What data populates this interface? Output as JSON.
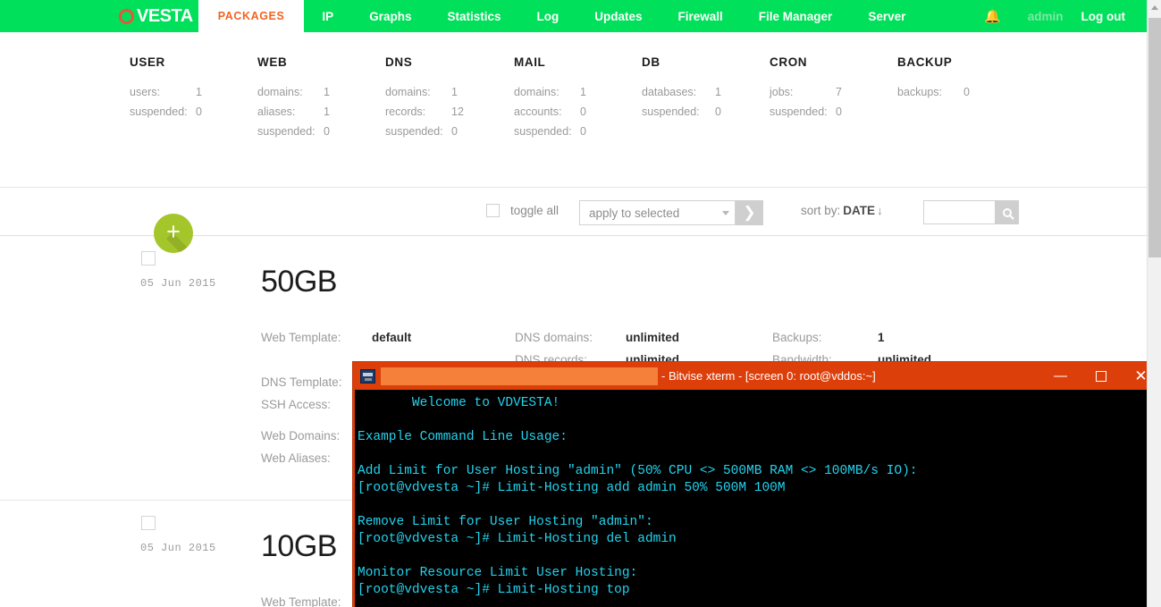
{
  "nav": {
    "brand": "VESTA",
    "brand_icon": "vesta-ring-icon",
    "items": [
      {
        "label": "PACKAGES",
        "active": true
      },
      {
        "label": "IP",
        "active": false
      },
      {
        "label": "Graphs",
        "active": false
      },
      {
        "label": "Statistics",
        "active": false
      },
      {
        "label": "Log",
        "active": false
      },
      {
        "label": "Updates",
        "active": false
      },
      {
        "label": "Firewall",
        "active": false
      },
      {
        "label": "File Manager",
        "active": false
      },
      {
        "label": "Server",
        "active": false
      }
    ],
    "bell_icon": "bell-icon",
    "user": "admin",
    "logout": "Log out",
    "accent_green": "#00e05a",
    "accent_orange": "#f06522"
  },
  "stats": [
    {
      "title": "USER",
      "rows": [
        {
          "key": "users:",
          "value": "1"
        },
        {
          "key": "suspended:",
          "value": "0"
        }
      ]
    },
    {
      "title": "WEB",
      "rows": [
        {
          "key": "domains:",
          "value": "1"
        },
        {
          "key": "aliases:",
          "value": "1"
        },
        {
          "key": "suspended:",
          "value": "0"
        }
      ]
    },
    {
      "title": "DNS",
      "rows": [
        {
          "key": "domains:",
          "value": "1"
        },
        {
          "key": "records:",
          "value": "12"
        },
        {
          "key": "suspended:",
          "value": "0"
        }
      ]
    },
    {
      "title": "MAIL",
      "rows": [
        {
          "key": "domains:",
          "value": "1"
        },
        {
          "key": "accounts:",
          "value": "0"
        },
        {
          "key": "suspended:",
          "value": "0"
        }
      ]
    },
    {
      "title": "DB",
      "rows": [
        {
          "key": "databases:",
          "value": "1"
        },
        {
          "key": "suspended:",
          "value": "0"
        }
      ]
    },
    {
      "title": "CRON",
      "rows": [
        {
          "key": "jobs:",
          "value": "7"
        },
        {
          "key": "suspended:",
          "value": "0"
        }
      ]
    },
    {
      "title": "BACKUP",
      "rows": [
        {
          "key": "backups:",
          "value": "0"
        }
      ]
    }
  ],
  "toolbar": {
    "toggle_all_label": "toggle all",
    "apply_select_value": "apply to selected",
    "go_icon": "chevron-right-icon",
    "sort_label": "sort by:",
    "sort_value": "DATE",
    "sort_direction": "↓",
    "search_value": "",
    "search_placeholder": "",
    "search_icon": "search-icon"
  },
  "add_button": {
    "icon": "plus-icon",
    "label": "+",
    "color": "#a5c62b"
  },
  "packages": [
    {
      "date": "05 Jun 2015",
      "name": "50GB",
      "fields_col_a": [
        {
          "label": "Web Template:",
          "value": "default"
        },
        {
          "label": "DNS Template:",
          "value": ""
        },
        {
          "label": "SSH Access:",
          "value": ""
        },
        {
          "label": "Web Domains:",
          "value": ""
        },
        {
          "label": "Web Aliases:",
          "value": ""
        }
      ],
      "fields_col_b": [
        {
          "label": "DNS domains:",
          "value": "unlimited"
        },
        {
          "label": "DNS records:",
          "value": "unlimited"
        }
      ],
      "fields_col_c": [
        {
          "label": "Backups:",
          "value": "1"
        },
        {
          "label": "Bandwidth:",
          "value": "unlimited"
        }
      ]
    },
    {
      "date": "05 Jun 2015",
      "name": "10GB",
      "fields_col_a": [
        {
          "label": "Web Template:",
          "value": ""
        }
      ],
      "fields_col_b": [],
      "fields_col_c": []
    }
  ],
  "terminal": {
    "app_icon": "terminal-app-icon",
    "title": "- Bitvise xterm - [screen 0: root@vddos:~]",
    "minimize_icon": "minimize-icon",
    "maximize_icon": "maximize-icon",
    "close_icon": "close-icon",
    "title_bg": "#dd3f0b",
    "text_color": "#22d3ee",
    "lines": [
      "       Welcome to VDVESTA!",
      "",
      "Example Command Line Usage:",
      "",
      "Add Limit for User Hosting \"admin\" (50% CPU <> 500MB RAM <> 100MB/s IO):",
      "[root@vdvesta ~]# Limit-Hosting add admin 50% 500M 100M",
      "",
      "Remove Limit for User Hosting \"admin\":",
      "[root@vdvesta ~]# Limit-Hosting del admin",
      "",
      "Monitor Resource Limit User Hosting:",
      "[root@vdvesta ~]# Limit-Hosting top"
    ]
  },
  "scrollbar": {
    "up_arrow_icon": "scroll-up-arrow-icon",
    "thumb": "scroll-thumb"
  }
}
